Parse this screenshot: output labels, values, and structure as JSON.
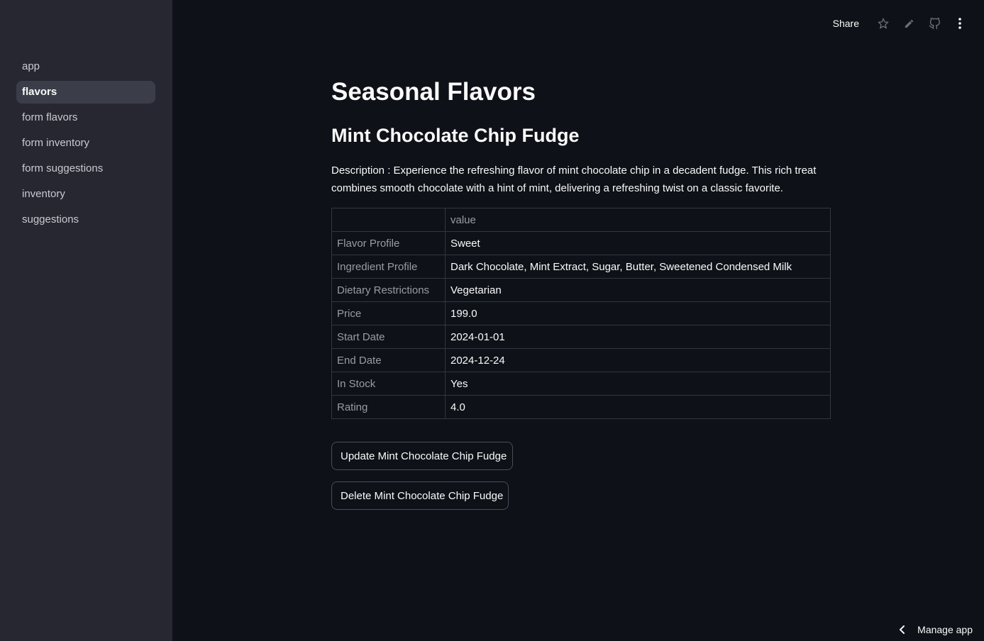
{
  "sidebar": {
    "items": [
      {
        "label": "app"
      },
      {
        "label": "flavors"
      },
      {
        "label": "form flavors"
      },
      {
        "label": "form inventory"
      },
      {
        "label": "form suggestions"
      },
      {
        "label": "inventory"
      },
      {
        "label": "suggestions"
      }
    ],
    "active": "flavors"
  },
  "toolbar": {
    "share_label": "Share",
    "icons": [
      "star-icon",
      "edit-icon",
      "github-icon",
      "more-vertical-icon"
    ]
  },
  "main": {
    "title": "Seasonal Flavors",
    "subtitle": "Mint Chocolate Chip Fudge",
    "description": "Description : Experience the refreshing flavor of mint chocolate chip in a decadent fudge. This rich treat combines smooth chocolate with a hint of mint, delivering a refreshing twist on a classic favorite.",
    "table": {
      "headers": [
        "",
        "value"
      ],
      "rows": [
        {
          "key": "Flavor Profile",
          "value": "Sweet"
        },
        {
          "key": "Ingredient Profile",
          "value": "Dark Chocolate, Mint Extract, Sugar, Butter, Sweetened Condensed Milk"
        },
        {
          "key": "Dietary Restrictions",
          "value": "Vegetarian"
        },
        {
          "key": "Price",
          "value": "199.0"
        },
        {
          "key": "Start Date",
          "value": "2024-01-01"
        },
        {
          "key": "End Date",
          "value": "2024-12-24"
        },
        {
          "key": "In Stock",
          "value": "Yes"
        },
        {
          "key": "Rating",
          "value": "4.0"
        }
      ]
    },
    "update_button": "Update Mint Chocolate Chip Fudge",
    "delete_button": "Delete Mint Chocolate Chip Fudge"
  },
  "footer": {
    "manage_label": "Manage app"
  },
  "colors": {
    "background": "#0e1117",
    "sidebar": "#262730",
    "active_nav": "#3b3d48",
    "text": "#fafafa",
    "muted_text": "#9a9ca3"
  }
}
